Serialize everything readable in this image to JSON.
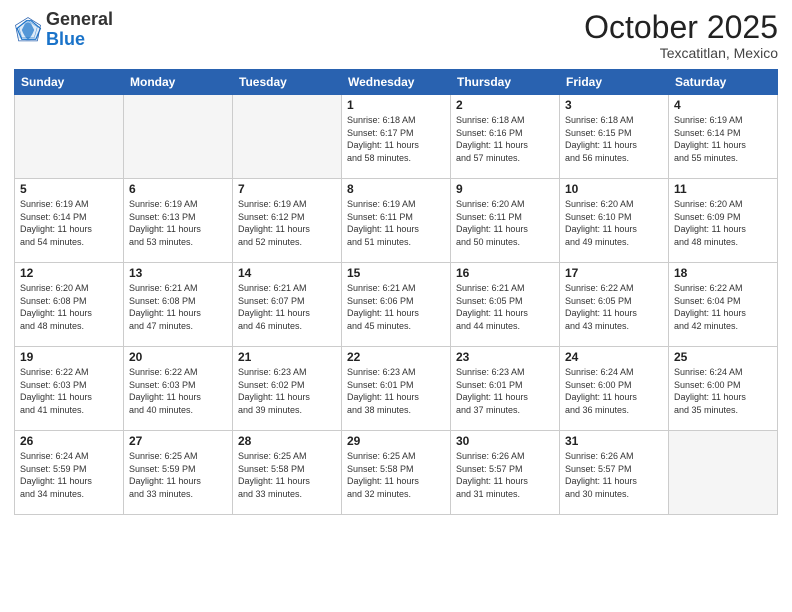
{
  "header": {
    "logo_general": "General",
    "logo_blue": "Blue",
    "month": "October 2025",
    "location": "Texcatitlan, Mexico"
  },
  "weekdays": [
    "Sunday",
    "Monday",
    "Tuesday",
    "Wednesday",
    "Thursday",
    "Friday",
    "Saturday"
  ],
  "weeks": [
    [
      {
        "day": "",
        "info": ""
      },
      {
        "day": "",
        "info": ""
      },
      {
        "day": "",
        "info": ""
      },
      {
        "day": "1",
        "info": "Sunrise: 6:18 AM\nSunset: 6:17 PM\nDaylight: 11 hours\nand 58 minutes."
      },
      {
        "day": "2",
        "info": "Sunrise: 6:18 AM\nSunset: 6:16 PM\nDaylight: 11 hours\nand 57 minutes."
      },
      {
        "day": "3",
        "info": "Sunrise: 6:18 AM\nSunset: 6:15 PM\nDaylight: 11 hours\nand 56 minutes."
      },
      {
        "day": "4",
        "info": "Sunrise: 6:19 AM\nSunset: 6:14 PM\nDaylight: 11 hours\nand 55 minutes."
      }
    ],
    [
      {
        "day": "5",
        "info": "Sunrise: 6:19 AM\nSunset: 6:14 PM\nDaylight: 11 hours\nand 54 minutes."
      },
      {
        "day": "6",
        "info": "Sunrise: 6:19 AM\nSunset: 6:13 PM\nDaylight: 11 hours\nand 53 minutes."
      },
      {
        "day": "7",
        "info": "Sunrise: 6:19 AM\nSunset: 6:12 PM\nDaylight: 11 hours\nand 52 minutes."
      },
      {
        "day": "8",
        "info": "Sunrise: 6:19 AM\nSunset: 6:11 PM\nDaylight: 11 hours\nand 51 minutes."
      },
      {
        "day": "9",
        "info": "Sunrise: 6:20 AM\nSunset: 6:11 PM\nDaylight: 11 hours\nand 50 minutes."
      },
      {
        "day": "10",
        "info": "Sunrise: 6:20 AM\nSunset: 6:10 PM\nDaylight: 11 hours\nand 49 minutes."
      },
      {
        "day": "11",
        "info": "Sunrise: 6:20 AM\nSunset: 6:09 PM\nDaylight: 11 hours\nand 48 minutes."
      }
    ],
    [
      {
        "day": "12",
        "info": "Sunrise: 6:20 AM\nSunset: 6:08 PM\nDaylight: 11 hours\nand 48 minutes."
      },
      {
        "day": "13",
        "info": "Sunrise: 6:21 AM\nSunset: 6:08 PM\nDaylight: 11 hours\nand 47 minutes."
      },
      {
        "day": "14",
        "info": "Sunrise: 6:21 AM\nSunset: 6:07 PM\nDaylight: 11 hours\nand 46 minutes."
      },
      {
        "day": "15",
        "info": "Sunrise: 6:21 AM\nSunset: 6:06 PM\nDaylight: 11 hours\nand 45 minutes."
      },
      {
        "day": "16",
        "info": "Sunrise: 6:21 AM\nSunset: 6:05 PM\nDaylight: 11 hours\nand 44 minutes."
      },
      {
        "day": "17",
        "info": "Sunrise: 6:22 AM\nSunset: 6:05 PM\nDaylight: 11 hours\nand 43 minutes."
      },
      {
        "day": "18",
        "info": "Sunrise: 6:22 AM\nSunset: 6:04 PM\nDaylight: 11 hours\nand 42 minutes."
      }
    ],
    [
      {
        "day": "19",
        "info": "Sunrise: 6:22 AM\nSunset: 6:03 PM\nDaylight: 11 hours\nand 41 minutes."
      },
      {
        "day": "20",
        "info": "Sunrise: 6:22 AM\nSunset: 6:03 PM\nDaylight: 11 hours\nand 40 minutes."
      },
      {
        "day": "21",
        "info": "Sunrise: 6:23 AM\nSunset: 6:02 PM\nDaylight: 11 hours\nand 39 minutes."
      },
      {
        "day": "22",
        "info": "Sunrise: 6:23 AM\nSunset: 6:01 PM\nDaylight: 11 hours\nand 38 minutes."
      },
      {
        "day": "23",
        "info": "Sunrise: 6:23 AM\nSunset: 6:01 PM\nDaylight: 11 hours\nand 37 minutes."
      },
      {
        "day": "24",
        "info": "Sunrise: 6:24 AM\nSunset: 6:00 PM\nDaylight: 11 hours\nand 36 minutes."
      },
      {
        "day": "25",
        "info": "Sunrise: 6:24 AM\nSunset: 6:00 PM\nDaylight: 11 hours\nand 35 minutes."
      }
    ],
    [
      {
        "day": "26",
        "info": "Sunrise: 6:24 AM\nSunset: 5:59 PM\nDaylight: 11 hours\nand 34 minutes."
      },
      {
        "day": "27",
        "info": "Sunrise: 6:25 AM\nSunset: 5:59 PM\nDaylight: 11 hours\nand 33 minutes."
      },
      {
        "day": "28",
        "info": "Sunrise: 6:25 AM\nSunset: 5:58 PM\nDaylight: 11 hours\nand 33 minutes."
      },
      {
        "day": "29",
        "info": "Sunrise: 6:25 AM\nSunset: 5:58 PM\nDaylight: 11 hours\nand 32 minutes."
      },
      {
        "day": "30",
        "info": "Sunrise: 6:26 AM\nSunset: 5:57 PM\nDaylight: 11 hours\nand 31 minutes."
      },
      {
        "day": "31",
        "info": "Sunrise: 6:26 AM\nSunset: 5:57 PM\nDaylight: 11 hours\nand 30 minutes."
      },
      {
        "day": "",
        "info": ""
      }
    ]
  ]
}
